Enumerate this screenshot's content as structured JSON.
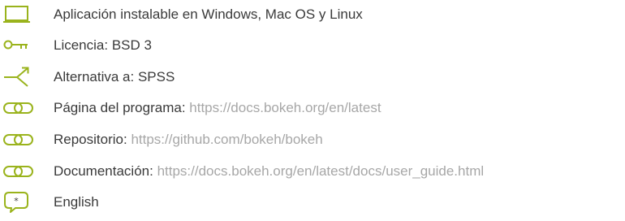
{
  "colors": {
    "icon": "#9ab31c",
    "text": "#3a3a3a",
    "link": "#a7a7a7"
  },
  "items": [
    {
      "icon": "laptop-icon",
      "text": "Aplicación instalable en Windows, Mac OS y Linux"
    },
    {
      "icon": "key-icon",
      "text": "Licencia: BSD 3"
    },
    {
      "icon": "alternative-arrow-icon",
      "text": "Alternativa a: SPSS"
    },
    {
      "icon": "link-icon",
      "label": "Página del programa:",
      "url": "https://docs.bokeh.org/en/latest"
    },
    {
      "icon": "link-icon",
      "label": "Repositorio:",
      "url": "https://github.com/bokeh/bokeh"
    },
    {
      "icon": "link-icon",
      "label": "Documentación:",
      "url": "https://docs.bokeh.org/en/latest/docs/user_guide.html"
    },
    {
      "icon": "speech-bubble-icon",
      "text": "English"
    }
  ]
}
